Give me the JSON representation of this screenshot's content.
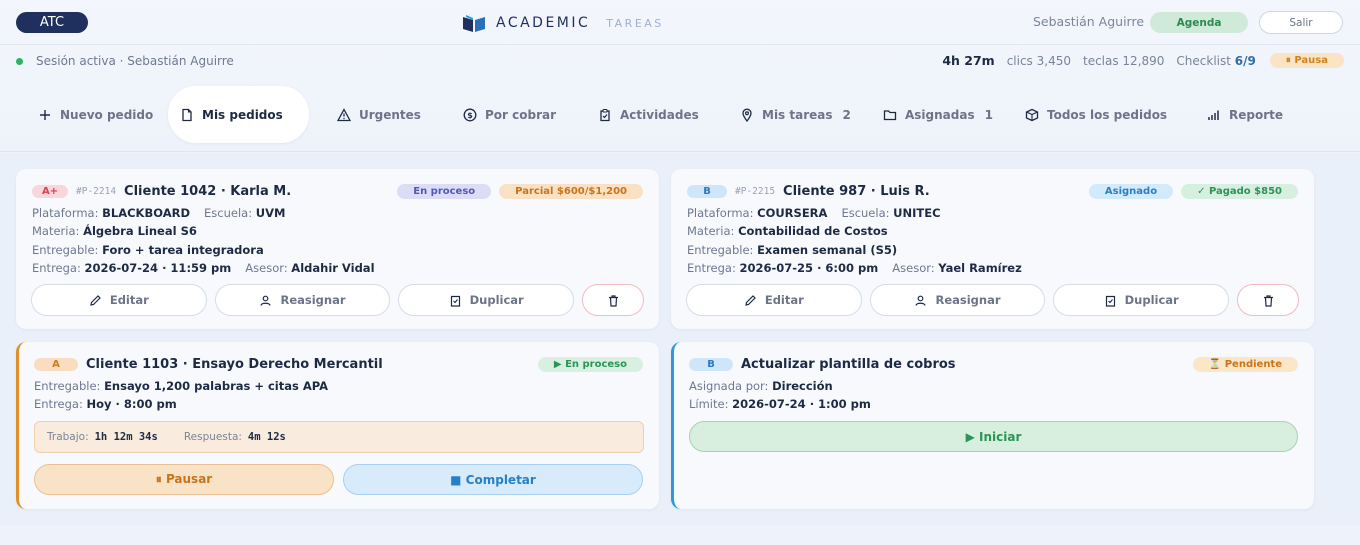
{
  "header": {
    "atc_label": "ATC",
    "brand_main": "ACADEMIC",
    "brand_sub": "TAREAS",
    "user_name": "Sebastián Aguirre",
    "agenda_label": "Agenda",
    "salir_label": "Salir"
  },
  "session": {
    "status_text": "Sesión activa · Sebastián Aguirre",
    "time": "4h 27m",
    "clicks": "clics 3,450",
    "keys": "teclas 12,890",
    "checklist_label": "Checklist",
    "checklist_value": "6/9",
    "pause_label": "⏸ Pausa"
  },
  "nav": {
    "items": [
      {
        "label": "Nuevo pedido",
        "icon": "plus-icon"
      },
      {
        "label": "Mis pedidos",
        "icon": "document-icon"
      },
      {
        "label": "Urgentes",
        "icon": "warning-icon"
      },
      {
        "label": "Por cobrar",
        "icon": "dollar-icon"
      },
      {
        "label": "Actividades",
        "icon": "clipboard-check-icon"
      },
      {
        "label": "Mis tareas",
        "icon": "pin-icon",
        "count": "2"
      },
      {
        "label": "Asignadas",
        "icon": "folder-icon",
        "count": "1"
      },
      {
        "label": "Todos los pedidos",
        "icon": "box-icon"
      },
      {
        "label": "Reporte",
        "icon": "bars-icon"
      }
    ]
  },
  "orders": [
    {
      "priority": "A+",
      "code": "#P-2214",
      "title": "Cliente 1042 · Karla M.",
      "status": "En proceso",
      "payment": "Parcial $600/$1,200",
      "platform_label": "Plataforma:",
      "platform": "BLACKBOARD",
      "school_label": "Escuela:",
      "school": "UVM",
      "subject_label": "Materia:",
      "subject": "Álgebra Lineal S6",
      "deliverable_label": "Entregable:",
      "deliverable": "Foro + tarea integradora",
      "due_label": "Entrega:",
      "due": "2026-07-24 · 11:59 pm",
      "advisor_label": "Asesor:",
      "advisor": "Aldahir Vidal"
    },
    {
      "priority": "B",
      "code": "#P-2215",
      "title": "Cliente 987 · Luis R.",
      "status": "Asignado",
      "payment": "✓ Pagado $850",
      "platform_label": "Plataforma:",
      "platform": "COURSERA",
      "school_label": "Escuela:",
      "school": "UNITEC",
      "subject_label": "Materia:",
      "subject": "Contabilidad de Costos",
      "deliverable_label": "Entregable:",
      "deliverable": "Examen semanal (S5)",
      "due_label": "Entrega:",
      "due": "2026-07-25 · 6:00 pm",
      "advisor_label": "Asesor:",
      "advisor": "Yael Ramírez"
    }
  ],
  "order_actions": {
    "edit": "Editar",
    "reassign": "Reasignar",
    "duplicate": "Duplicar"
  },
  "task_active": {
    "priority": "A",
    "title": "Cliente 1103 · Ensayo Derecho Mercantil",
    "status": "▶ En proceso",
    "deliverable_label": "Entregable:",
    "deliverable": "Ensayo 1,200 palabras + citas APA",
    "due_label": "Entrega:",
    "due": "Hoy · 8:00 pm",
    "work_label": "Trabajo:",
    "work_time": "1h 12m 34s",
    "response_label": "Respuesta:",
    "response_time": "4m 12s",
    "pause_label": "⏸ Pausar",
    "complete_label": "■ Completar"
  },
  "task_pending": {
    "priority": "B",
    "title": "Actualizar plantilla de cobros",
    "status": "⏳ Pendiente",
    "assigned_label": "Asignada por:",
    "assigned_by": "Dirección",
    "limit_label": "Límite:",
    "limit": "2026-07-24 · 1:00 pm",
    "start_label": "▶ Iniciar"
  },
  "colors": {
    "brand_navy": "#1f2f5e",
    "accent_orange": "#e0902a",
    "accent_blue": "#2a9bd8",
    "success_green": "#2a9555",
    "danger_red": "#d9414f"
  }
}
